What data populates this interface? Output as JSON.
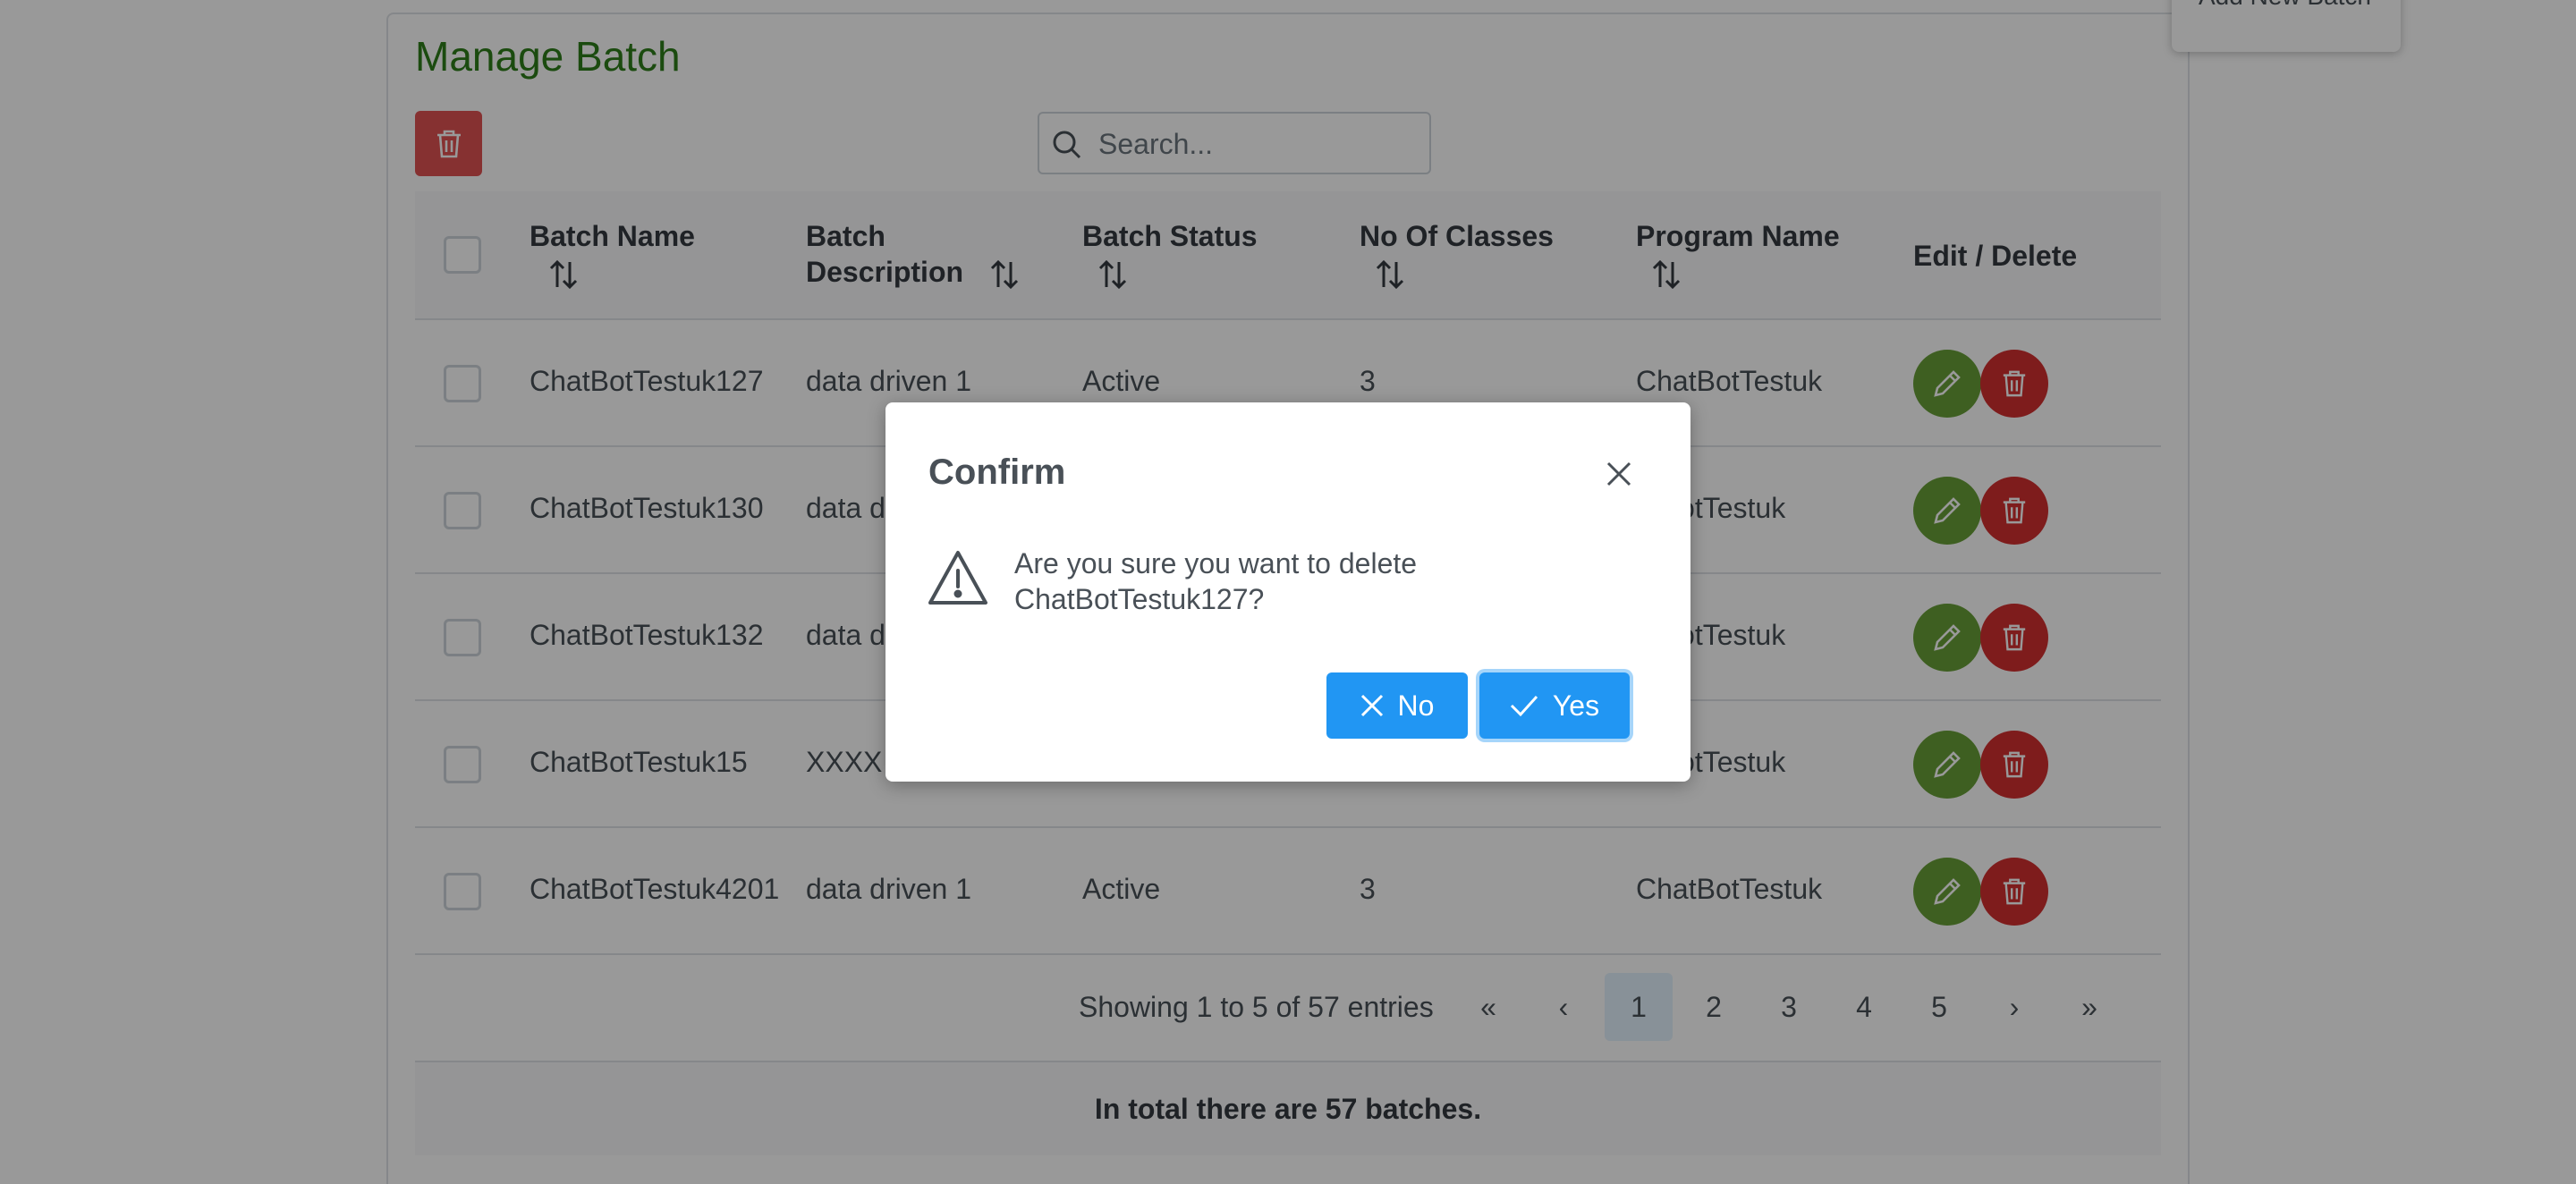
{
  "page": {
    "title": "Manage Batch",
    "search_placeholder": "Search...",
    "menu_popup_text": "Add New Batch"
  },
  "table": {
    "columns": [
      "Batch Name",
      "Batch Description",
      "Batch Status",
      "No Of Classes",
      "Program Name",
      "Edit / Delete"
    ],
    "column_desc_line1": "Batch",
    "column_desc_line2": "Description",
    "rows": [
      {
        "name": "ChatBotTestuk127",
        "description": "data driven 1",
        "status": "Active",
        "classes": "3",
        "program": "ChatBotTestuk"
      },
      {
        "name": "ChatBotTestuk130",
        "description": "data d",
        "status": "",
        "classes": "",
        "program": "atBotTestuk"
      },
      {
        "name": "ChatBotTestuk132",
        "description": "data d",
        "status": "",
        "classes": "",
        "program": "atBotTestuk"
      },
      {
        "name": "ChatBotTestuk15",
        "description": "XXXX",
        "status": "",
        "classes": "",
        "program": "atBotTestuk"
      },
      {
        "name": "ChatBotTestuk4201",
        "description": "data driven 1",
        "status": "Active",
        "classes": "3",
        "program": "ChatBotTestuk"
      }
    ]
  },
  "paginator": {
    "showing": "Showing 1 to 5 of 57 entries",
    "first": "«",
    "prev": "‹",
    "pages": [
      "1",
      "2",
      "3",
      "4",
      "5"
    ],
    "active_page": "1",
    "next": "›",
    "last": "»"
  },
  "footer": {
    "total": "In total there are 57 batches."
  },
  "dialog": {
    "title": "Confirm",
    "message": "Are you sure you want to delete ChatBotTestuk127?",
    "no_label": "No",
    "yes_label": "Yes"
  },
  "colors": {
    "primary": "#2196f3",
    "edit": "#689f38",
    "delete": "#d32f2f",
    "title_green": "#2e7d1a"
  },
  "icons": {
    "bulk_delete": "trash-icon",
    "search": "search-icon",
    "sort": "sort-icon",
    "edit": "pencil-icon",
    "delete": "trash-icon",
    "close": "close-icon",
    "warning": "warning-icon",
    "no": "times-icon",
    "yes": "check-icon"
  }
}
